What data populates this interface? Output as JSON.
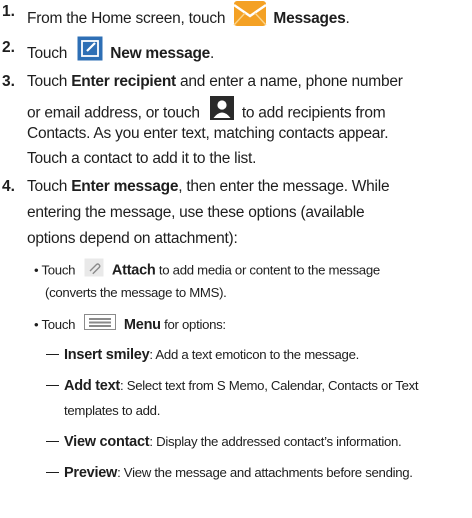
{
  "steps": [
    {
      "number": "1.",
      "pre": "From the Home screen, touch",
      "icon": "messages-envelope-icon",
      "bold": "Messages",
      "post": "."
    },
    {
      "number": "2.",
      "pre": "Touch",
      "icon": "new-message-compose-icon",
      "bold": "New message",
      "post": "."
    },
    {
      "number": "3.",
      "line1_pre": "Touch",
      "line1_bold": "Enter recipient",
      "line1_post": "and enter a name, phone number",
      "line2_pre": "or email address, or touch",
      "line2_icon": "contacts-person-icon",
      "line2_post": "to add recipients from",
      "line3": "Contacts. As you enter text, matching contacts appear.",
      "line4": "Touch a contact to add it to the list."
    },
    {
      "number": "4.",
      "line1_pre": "Touch",
      "line1_bold": "Enter message",
      "line1_post": ", then enter the message. While",
      "line2": "entering the message, use these options (available",
      "line3": "options depend on attachment):"
    }
  ],
  "bullets": [
    {
      "pre": "Touch",
      "icon": "paperclip-attach-icon",
      "bold": "Attach",
      "post": "to add media or content to the message",
      "line2": "(converts the message to MMS)."
    },
    {
      "pre": "Touch",
      "icon": "menu-lines-icon",
      "bold": "Menu",
      "post": "for options:"
    }
  ],
  "options": [
    {
      "bold": "Insert smiley",
      "text": ": Add a text emoticon to the message.",
      "line2": ""
    },
    {
      "bold": "Add text",
      "text": ": Select text from S Memo, Calendar, Contacts or Text",
      "line2": "templates to add."
    },
    {
      "bold": "View contact",
      "text": ": Display the addressed contact’s information.",
      "line2": ""
    },
    {
      "bold": "Preview",
      "text": ": View the message and attachments before sending.",
      "line2": ""
    }
  ],
  "colors": {
    "text": "#1e1e1e",
    "messages_icon_orange": "#f4a124",
    "compose_icon_blue": "#2e6fb5",
    "contacts_icon_dark": "#2a2a2a",
    "icon_gray": "#8a8a8a"
  }
}
